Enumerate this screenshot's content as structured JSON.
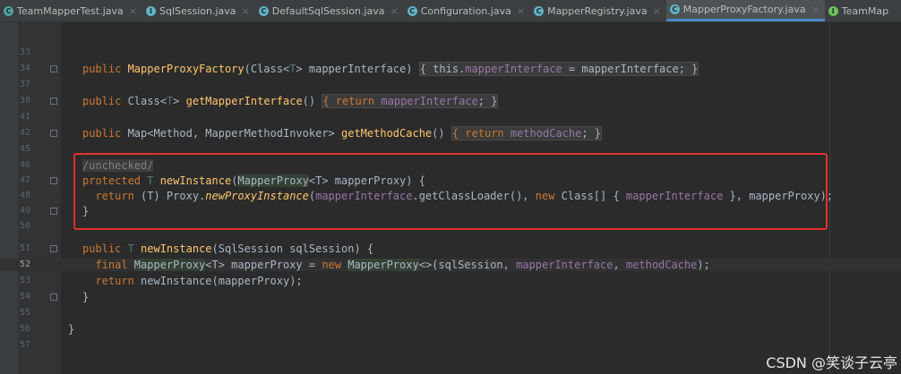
{
  "tabs": [
    {
      "label": "TeamMapperTest.java",
      "icon": "junit-class-icon",
      "color": "#4ea3a3"
    },
    {
      "label": "SqlSession.java",
      "icon": "interface-icon",
      "color": "#5fb3c6"
    },
    {
      "label": "DefaultSqlSession.java",
      "icon": "class-icon",
      "color": "#5fb3c6"
    },
    {
      "label": "Configuration.java",
      "icon": "class-icon",
      "color": "#5fb3c6"
    },
    {
      "label": "MapperRegistry.java",
      "icon": "class-icon",
      "color": "#5fb3c6"
    },
    {
      "label": "MapperProxyFactory.java",
      "icon": "class-icon",
      "color": "#5fb3c6",
      "active": true
    },
    {
      "label": "TeamMap",
      "icon": "interface-icon",
      "color": "#6cbf5a"
    }
  ],
  "gutter": {
    "line_numbers": [
      "33",
      "34",
      "37",
      "38",
      "41",
      "42",
      "45",
      "46",
      "47",
      "48",
      "49",
      "50",
      "51",
      "52",
      "53",
      "54",
      "55",
      "56",
      "57"
    ],
    "current_line": "52"
  },
  "code": {
    "l33": "",
    "l34a": "public ",
    "l34b": "MapperProxyFactory",
    "l34c": "(Class<",
    "l34d": "T",
    "l34e": "> mapperInterface) ",
    "l34f": "{ this.",
    "l34g": "mapperInterface",
    "l34h": " = mapperInterface; }",
    "l38a": "public ",
    "l38b": "Class<",
    "l38c": "T",
    "l38d": "> ",
    "l38e": "getMapperInterface",
    "l38f": "() ",
    "l38g": "{ return ",
    "l38h": "mapperInterface",
    "l38i": "; }",
    "l42a": "public ",
    "l42b": "Map<Method, MapperMethodInvoker> ",
    "l42c": "getMethodCache",
    "l42d": "() ",
    "l42e": "{ return ",
    "l42f": "methodCache",
    "l42g": "; }",
    "l46": "/unchecked/",
    "l47a": "protected ",
    "l47b": "T ",
    "l47c": "newInstance",
    "l47d": "(",
    "l47e": "MapperProxy",
    "l47f": "<T> mapperProxy) {",
    "l48a": "  return ",
    "l48b": "(T) Proxy.",
    "l48c": "newProxyInstance",
    "l48d": "(",
    "l48e": "mapperInterface",
    "l48f": ".getClassLoader(), ",
    "l48g": "new ",
    "l48h": "Class[] { ",
    "l48i": "mapperInterface",
    "l48j": " }, mapperProxy);",
    "l49": "}",
    "l51a": "public ",
    "l51b": "T ",
    "l51c": "newInstance",
    "l51d": "(SqlSession sqlSession) {",
    "l52a": "  final ",
    "l52b": "MapperProxy",
    "l52c": "<T> mapperProxy = ",
    "l52d": "new ",
    "l52e": "MapperProxy",
    "l52f": "<>(sqlSession, ",
    "l52g": "mapperInterface",
    "l52h": ", ",
    "l52i": "methodCache",
    "l52j": ");",
    "l53a": "  return ",
    "l53b": "newInstance(mapperProxy);",
    "l54": "}",
    "l56": "}"
  },
  "watermark": "CSDN @笑谈子云亭"
}
